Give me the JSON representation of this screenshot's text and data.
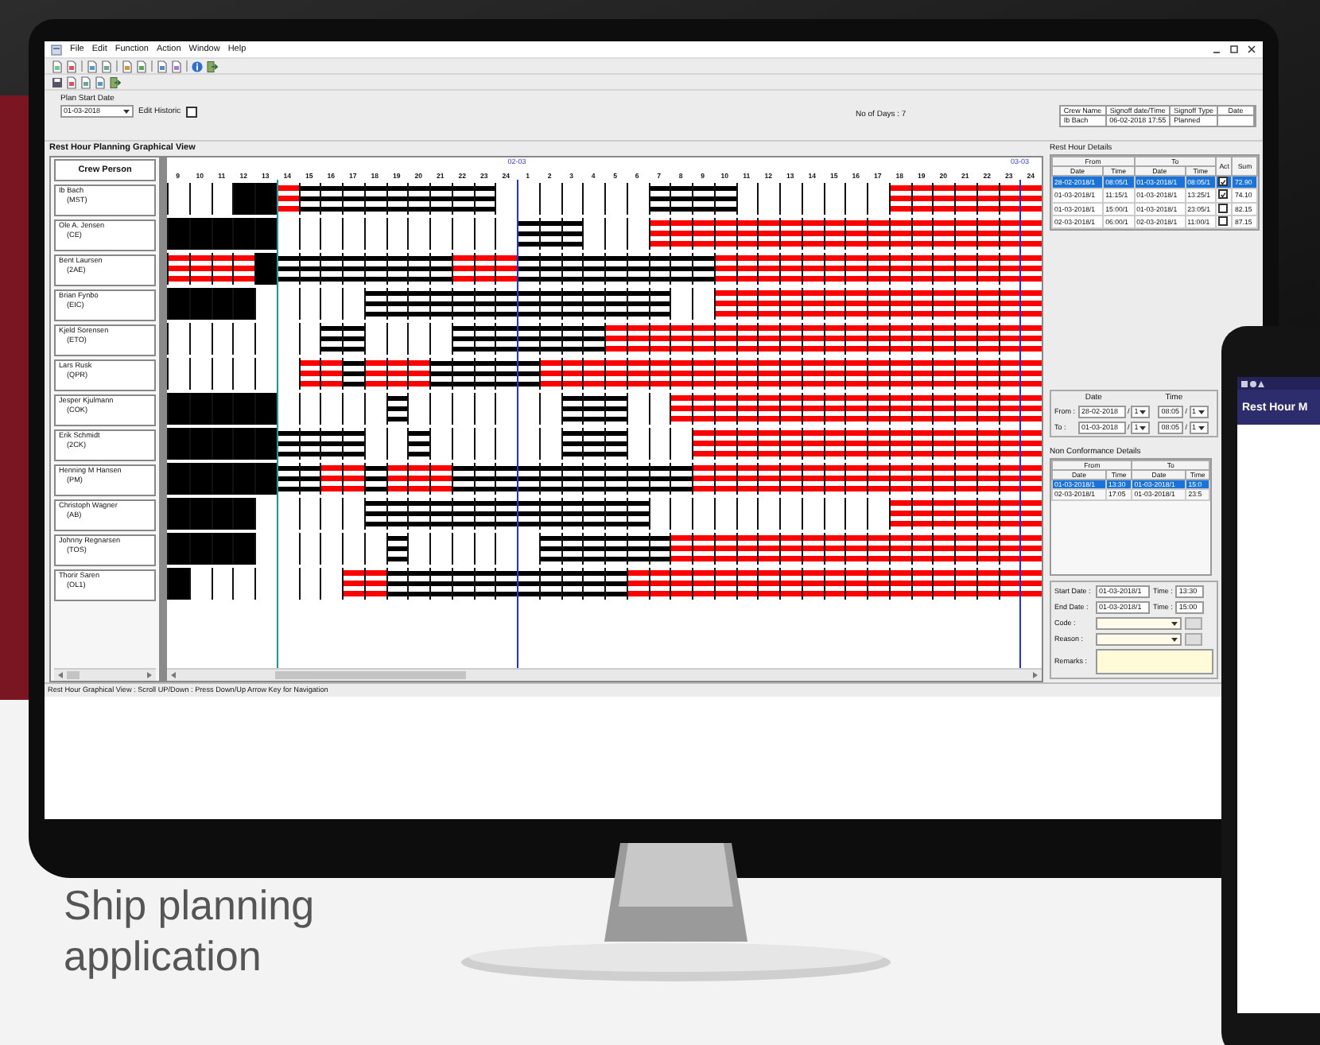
{
  "window": {
    "menu": [
      "File",
      "Edit",
      "Function",
      "Action",
      "Window",
      "Help"
    ]
  },
  "plan_start": {
    "label": "Plan Start Date",
    "value": "01-03-2018",
    "edit_historic": {
      "label": "Edit Historic",
      "checked": false
    }
  },
  "days": "No of Days : 7",
  "signoff": [
    {
      "header": "Crew Name",
      "value": "Ib Bach"
    },
    {
      "header": "Signoff date/Time",
      "value": "06-02-2018 17:55"
    },
    {
      "header": "Signoff Type",
      "value": "Planned"
    },
    {
      "header": "Date"
    }
  ],
  "graph": {
    "title": "Rest Hour Planning Graphical View",
    "crew_header": "Crew Person",
    "hours": [
      {
        "label": "9"
      },
      {
        "label": "10"
      },
      {
        "label": "11"
      },
      {
        "label": "12"
      },
      {
        "label": "13"
      },
      {
        "label": "14",
        "current": true
      },
      {
        "label": "15"
      },
      {
        "label": "16"
      },
      {
        "label": "17"
      },
      {
        "label": "18"
      },
      {
        "label": "19"
      },
      {
        "label": "20"
      },
      {
        "label": "21"
      },
      {
        "label": "22"
      },
      {
        "label": "23"
      },
      {
        "label": "24"
      },
      {
        "label": "1",
        "date": "02-03"
      },
      {
        "label": "2"
      },
      {
        "label": "3"
      },
      {
        "label": "4"
      },
      {
        "label": "5"
      },
      {
        "label": "6"
      },
      {
        "label": "7"
      },
      {
        "label": "8"
      },
      {
        "label": "9"
      },
      {
        "label": "10"
      },
      {
        "label": "11"
      },
      {
        "label": "12"
      },
      {
        "label": "13"
      },
      {
        "label": "14"
      },
      {
        "label": "15"
      },
      {
        "label": "16"
      },
      {
        "label": "17"
      },
      {
        "label": "18"
      },
      {
        "label": "19"
      },
      {
        "label": "20"
      },
      {
        "label": "21"
      },
      {
        "label": "22"
      },
      {
        "label": "23"
      },
      {
        "label": "24",
        "date": "03-03"
      }
    ],
    "crew": [
      {
        "name": "Ib Bach",
        "rank": "(MST)",
        "hours": [
          {
            "kind": "empty"
          },
          {
            "kind": "empty"
          },
          {
            "kind": "empty"
          },
          {
            "kind": "solid"
          },
          {
            "kind": "solid"
          },
          {
            "kind": "violation"
          },
          {
            "kind": "planned"
          },
          {
            "kind": "planned"
          },
          {
            "kind": "planned"
          },
          {
            "kind": "planned"
          },
          {
            "kind": "planned"
          },
          {
            "kind": "planned"
          },
          {
            "kind": "planned"
          },
          {
            "kind": "planned"
          },
          {
            "kind": "planned"
          },
          {
            "kind": "empty"
          },
          {
            "kind": "empty"
          },
          {
            "kind": "empty"
          },
          {
            "kind": "empty"
          },
          {
            "kind": "empty"
          },
          {
            "kind": "empty"
          },
          {
            "kind": "empty"
          },
          {
            "kind": "planned"
          },
          {
            "kind": "planned"
          },
          {
            "kind": "planned"
          },
          {
            "kind": "planned"
          },
          {
            "kind": "empty"
          },
          {
            "kind": "empty"
          },
          {
            "kind": "empty"
          },
          {
            "kind": "empty"
          },
          {
            "kind": "empty"
          },
          {
            "kind": "empty"
          },
          {
            "kind": "empty"
          },
          {
            "kind": "violation"
          },
          {
            "kind": "violation"
          },
          {
            "kind": "violation"
          },
          {
            "kind": "violation"
          },
          {
            "kind": "violation"
          },
          {
            "kind": "violation"
          },
          {
            "kind": "violation"
          }
        ]
      },
      {
        "name": "Ole A. Jensen",
        "rank": "(CE)",
        "hours": [
          {
            "kind": "solid"
          },
          {
            "kind": "solid"
          },
          {
            "kind": "solid"
          },
          {
            "kind": "solid"
          },
          {
            "kind": "solid"
          },
          {
            "kind": "empty"
          },
          {
            "kind": "empty"
          },
          {
            "kind": "empty"
          },
          {
            "kind": "empty"
          },
          {
            "kind": "empty"
          },
          {
            "kind": "empty"
          },
          {
            "kind": "empty"
          },
          {
            "kind": "empty"
          },
          {
            "kind": "empty"
          },
          {
            "kind": "empty"
          },
          {
            "kind": "empty"
          },
          {
            "kind": "planned"
          },
          {
            "kind": "planned"
          },
          {
            "kind": "planned"
          },
          {
            "kind": "empty"
          },
          {
            "kind": "empty"
          },
          {
            "kind": "empty"
          },
          {
            "kind": "violation"
          },
          {
            "kind": "violation"
          },
          {
            "kind": "violation"
          },
          {
            "kind": "violation"
          },
          {
            "kind": "violation"
          },
          {
            "kind": "violation"
          },
          {
            "kind": "violation"
          },
          {
            "kind": "violation"
          },
          {
            "kind": "violation"
          },
          {
            "kind": "violation"
          },
          {
            "kind": "violation"
          },
          {
            "kind": "violation"
          },
          {
            "kind": "violation"
          },
          {
            "kind": "violation"
          },
          {
            "kind": "violation"
          },
          {
            "kind": "violation"
          },
          {
            "kind": "violation"
          },
          {
            "kind": "violation"
          }
        ]
      },
      {
        "name": "Bent Laursen",
        "rank": "(2AE)",
        "hours": [
          {
            "kind": "violation"
          },
          {
            "kind": "violation"
          },
          {
            "kind": "violation"
          },
          {
            "kind": "violation"
          },
          {
            "kind": "solid"
          },
          {
            "kind": "planned"
          },
          {
            "kind": "planned"
          },
          {
            "kind": "planned"
          },
          {
            "kind": "planned"
          },
          {
            "kind": "planned"
          },
          {
            "kind": "planned"
          },
          {
            "kind": "planned"
          },
          {
            "kind": "planned"
          },
          {
            "kind": "violation"
          },
          {
            "kind": "violation"
          },
          {
            "kind": "violation"
          },
          {
            "kind": "planned"
          },
          {
            "kind": "planned"
          },
          {
            "kind": "planned"
          },
          {
            "kind": "planned"
          },
          {
            "kind": "planned"
          },
          {
            "kind": "planned"
          },
          {
            "kind": "planned"
          },
          {
            "kind": "planned"
          },
          {
            "kind": "planned"
          },
          {
            "kind": "violation"
          },
          {
            "kind": "violation"
          },
          {
            "kind": "violation"
          },
          {
            "kind": "violation"
          },
          {
            "kind": "violation"
          },
          {
            "kind": "violation"
          },
          {
            "kind": "violation"
          },
          {
            "kind": "violation"
          },
          {
            "kind": "violation"
          },
          {
            "kind": "violation"
          },
          {
            "kind": "violation"
          },
          {
            "kind": "violation"
          },
          {
            "kind": "violation"
          },
          {
            "kind": "violation"
          },
          {
            "kind": "violation"
          }
        ]
      },
      {
        "name": "Brian Fynbo",
        "rank": "(EIC)",
        "hours": [
          {
            "kind": "solid"
          },
          {
            "kind": "solid"
          },
          {
            "kind": "solid"
          },
          {
            "kind": "solid"
          },
          {
            "kind": "empty"
          },
          {
            "kind": "empty"
          },
          {
            "kind": "empty"
          },
          {
            "kind": "empty"
          },
          {
            "kind": "empty"
          },
          {
            "kind": "planned"
          },
          {
            "kind": "planned"
          },
          {
            "kind": "planned"
          },
          {
            "kind": "planned"
          },
          {
            "kind": "planned"
          },
          {
            "kind": "planned"
          },
          {
            "kind": "planned"
          },
          {
            "kind": "planned"
          },
          {
            "kind": "planned"
          },
          {
            "kind": "planned"
          },
          {
            "kind": "planned"
          },
          {
            "kind": "planned"
          },
          {
            "kind": "planned"
          },
          {
            "kind": "planned"
          },
          {
            "kind": "empty"
          },
          {
            "kind": "empty"
          },
          {
            "kind": "violation"
          },
          {
            "kind": "violation"
          },
          {
            "kind": "violation"
          },
          {
            "kind": "violation"
          },
          {
            "kind": "violation"
          },
          {
            "kind": "violation"
          },
          {
            "kind": "violation"
          },
          {
            "kind": "violation"
          },
          {
            "kind": "violation"
          },
          {
            "kind": "violation"
          },
          {
            "kind": "violation"
          },
          {
            "kind": "violation"
          },
          {
            "kind": "violation"
          },
          {
            "kind": "violation"
          },
          {
            "kind": "violation"
          }
        ]
      },
      {
        "name": "Kjeld Sorensen",
        "rank": "(ETO)",
        "hours": [
          {
            "kind": "empty"
          },
          {
            "kind": "empty"
          },
          {
            "kind": "empty"
          },
          {
            "kind": "empty"
          },
          {
            "kind": "empty"
          },
          {
            "kind": "empty"
          },
          {
            "kind": "empty"
          },
          {
            "kind": "planned"
          },
          {
            "kind": "planned"
          },
          {
            "kind": "empty"
          },
          {
            "kind": "empty"
          },
          {
            "kind": "empty"
          },
          {
            "kind": "empty"
          },
          {
            "kind": "planned"
          },
          {
            "kind": "planned"
          },
          {
            "kind": "planned"
          },
          {
            "kind": "planned"
          },
          {
            "kind": "planned"
          },
          {
            "kind": "planned"
          },
          {
            "kind": "planned"
          },
          {
            "kind": "violation"
          },
          {
            "kind": "violation"
          },
          {
            "kind": "violation"
          },
          {
            "kind": "violation"
          },
          {
            "kind": "violation"
          },
          {
            "kind": "violation"
          },
          {
            "kind": "violation"
          },
          {
            "kind": "violation"
          },
          {
            "kind": "violation"
          },
          {
            "kind": "violation"
          },
          {
            "kind": "violation"
          },
          {
            "kind": "violation"
          },
          {
            "kind": "violation"
          },
          {
            "kind": "violation"
          },
          {
            "kind": "violation"
          },
          {
            "kind": "violation"
          },
          {
            "kind": "violation"
          },
          {
            "kind": "violation"
          },
          {
            "kind": "violation"
          },
          {
            "kind": "violation"
          }
        ]
      },
      {
        "name": "Lars Rusk",
        "rank": "(QPR)",
        "hours": [
          {
            "kind": "empty"
          },
          {
            "kind": "empty"
          },
          {
            "kind": "empty"
          },
          {
            "kind": "empty"
          },
          {
            "kind": "empty"
          },
          {
            "kind": "empty"
          },
          {
            "kind": "violation"
          },
          {
            "kind": "violation"
          },
          {
            "kind": "planned"
          },
          {
            "kind": "violation"
          },
          {
            "kind": "violation"
          },
          {
            "kind": "violation"
          },
          {
            "kind": "planned"
          },
          {
            "kind": "planned"
          },
          {
            "kind": "planned"
          },
          {
            "kind": "planned"
          },
          {
            "kind": "planned"
          },
          {
            "kind": "violation"
          },
          {
            "kind": "violation"
          },
          {
            "kind": "violation"
          },
          {
            "kind": "violation"
          },
          {
            "kind": "violation"
          },
          {
            "kind": "violation"
          },
          {
            "kind": "violation"
          },
          {
            "kind": "violation"
          },
          {
            "kind": "violation"
          },
          {
            "kind": "violation"
          },
          {
            "kind": "violation"
          },
          {
            "kind": "violation"
          },
          {
            "kind": "violation"
          },
          {
            "kind": "violation"
          },
          {
            "kind": "violation"
          },
          {
            "kind": "violation"
          },
          {
            "kind": "violation"
          },
          {
            "kind": "violation"
          },
          {
            "kind": "violation"
          },
          {
            "kind": "violation"
          },
          {
            "kind": "violation"
          },
          {
            "kind": "violation"
          },
          {
            "kind": "violation"
          }
        ]
      },
      {
        "name": "Jesper Kjulmann",
        "rank": "(COK)",
        "hours": [
          {
            "kind": "solid"
          },
          {
            "kind": "solid"
          },
          {
            "kind": "solid"
          },
          {
            "kind": "solid"
          },
          {
            "kind": "solid"
          },
          {
            "kind": "empty"
          },
          {
            "kind": "empty"
          },
          {
            "kind": "empty"
          },
          {
            "kind": "empty"
          },
          {
            "kind": "empty"
          },
          {
            "kind": "planned"
          },
          {
            "kind": "empty"
          },
          {
            "kind": "empty"
          },
          {
            "kind": "empty"
          },
          {
            "kind": "empty"
          },
          {
            "kind": "empty"
          },
          {
            "kind": "empty"
          },
          {
            "kind": "empty"
          },
          {
            "kind": "planned"
          },
          {
            "kind": "planned"
          },
          {
            "kind": "planned"
          },
          {
            "kind": "empty"
          },
          {
            "kind": "empty"
          },
          {
            "kind": "violation"
          },
          {
            "kind": "violation"
          },
          {
            "kind": "violation"
          },
          {
            "kind": "violation"
          },
          {
            "kind": "violation"
          },
          {
            "kind": "violation"
          },
          {
            "kind": "violation"
          },
          {
            "kind": "violation"
          },
          {
            "kind": "violation"
          },
          {
            "kind": "violation"
          },
          {
            "kind": "violation"
          },
          {
            "kind": "violation"
          },
          {
            "kind": "violation"
          },
          {
            "kind": "violation"
          },
          {
            "kind": "violation"
          },
          {
            "kind": "violation"
          },
          {
            "kind": "violation"
          }
        ]
      },
      {
        "name": "Erik Schmidt",
        "rank": "(2CK)",
        "hours": [
          {
            "kind": "solid"
          },
          {
            "kind": "solid"
          },
          {
            "kind": "solid"
          },
          {
            "kind": "solid"
          },
          {
            "kind": "solid"
          },
          {
            "kind": "planned"
          },
          {
            "kind": "planned"
          },
          {
            "kind": "planned"
          },
          {
            "kind": "planned"
          },
          {
            "kind": "empty"
          },
          {
            "kind": "empty"
          },
          {
            "kind": "planned"
          },
          {
            "kind": "empty"
          },
          {
            "kind": "empty"
          },
          {
            "kind": "empty"
          },
          {
            "kind": "empty"
          },
          {
            "kind": "empty"
          },
          {
            "kind": "empty"
          },
          {
            "kind": "planned"
          },
          {
            "kind": "planned"
          },
          {
            "kind": "planned"
          },
          {
            "kind": "empty"
          },
          {
            "kind": "empty"
          },
          {
            "kind": "empty"
          },
          {
            "kind": "violation"
          },
          {
            "kind": "violation"
          },
          {
            "kind": "violation"
          },
          {
            "kind": "violation"
          },
          {
            "kind": "violation"
          },
          {
            "kind": "violation"
          },
          {
            "kind": "violation"
          },
          {
            "kind": "violation"
          },
          {
            "kind": "violation"
          },
          {
            "kind": "violation"
          },
          {
            "kind": "violation"
          },
          {
            "kind": "violation"
          },
          {
            "kind": "violation"
          },
          {
            "kind": "violation"
          },
          {
            "kind": "violation"
          },
          {
            "kind": "violation"
          }
        ]
      },
      {
        "name": "Henning M Hansen",
        "rank": "(PM)",
        "hours": [
          {
            "kind": "solid"
          },
          {
            "kind": "solid"
          },
          {
            "kind": "solid"
          },
          {
            "kind": "solid"
          },
          {
            "kind": "solid"
          },
          {
            "kind": "planned"
          },
          {
            "kind": "planned"
          },
          {
            "kind": "violation"
          },
          {
            "kind": "violation"
          },
          {
            "kind": "planned"
          },
          {
            "kind": "violation"
          },
          {
            "kind": "violation"
          },
          {
            "kind": "violation"
          },
          {
            "kind": "planned"
          },
          {
            "kind": "planned"
          },
          {
            "kind": "planned"
          },
          {
            "kind": "planned"
          },
          {
            "kind": "planned"
          },
          {
            "kind": "planned"
          },
          {
            "kind": "planned"
          },
          {
            "kind": "planned"
          },
          {
            "kind": "planned"
          },
          {
            "kind": "planned"
          },
          {
            "kind": "planned"
          },
          {
            "kind": "violation"
          },
          {
            "kind": "violation"
          },
          {
            "kind": "violation"
          },
          {
            "kind": "violation"
          },
          {
            "kind": "violation"
          },
          {
            "kind": "violation"
          },
          {
            "kind": "violation"
          },
          {
            "kind": "violation"
          },
          {
            "kind": "violation"
          },
          {
            "kind": "violation"
          },
          {
            "kind": "violation"
          },
          {
            "kind": "violation"
          },
          {
            "kind": "violation"
          },
          {
            "kind": "violation"
          },
          {
            "kind": "violation"
          },
          {
            "kind": "violation"
          }
        ]
      },
      {
        "name": "Christoph Wagner",
        "rank": "(AB)",
        "hours": [
          {
            "kind": "solid"
          },
          {
            "kind": "solid"
          },
          {
            "kind": "solid"
          },
          {
            "kind": "solid"
          },
          {
            "kind": "empty"
          },
          {
            "kind": "empty"
          },
          {
            "kind": "empty"
          },
          {
            "kind": "empty"
          },
          {
            "kind": "empty"
          },
          {
            "kind": "planned"
          },
          {
            "kind": "planned"
          },
          {
            "kind": "planned"
          },
          {
            "kind": "planned"
          },
          {
            "kind": "planned"
          },
          {
            "kind": "planned"
          },
          {
            "kind": "planned"
          },
          {
            "kind": "planned"
          },
          {
            "kind": "planned"
          },
          {
            "kind": "planned"
          },
          {
            "kind": "planned"
          },
          {
            "kind": "planned"
          },
          {
            "kind": "planned"
          },
          {
            "kind": "empty"
          },
          {
            "kind": "empty"
          },
          {
            "kind": "empty"
          },
          {
            "kind": "empty"
          },
          {
            "kind": "empty"
          },
          {
            "kind": "empty"
          },
          {
            "kind": "empty"
          },
          {
            "kind": "empty"
          },
          {
            "kind": "empty"
          },
          {
            "kind": "empty"
          },
          {
            "kind": "empty"
          },
          {
            "kind": "violation"
          },
          {
            "kind": "violation"
          },
          {
            "kind": "violation"
          },
          {
            "kind": "violation"
          },
          {
            "kind": "violation"
          },
          {
            "kind": "violation"
          },
          {
            "kind": "violation"
          }
        ]
      },
      {
        "name": "Johnny Regnarsen",
        "rank": "(TOS)",
        "hours": [
          {
            "kind": "solid"
          },
          {
            "kind": "solid"
          },
          {
            "kind": "solid"
          },
          {
            "kind": "solid"
          },
          {
            "kind": "empty"
          },
          {
            "kind": "empty"
          },
          {
            "kind": "empty"
          },
          {
            "kind": "empty"
          },
          {
            "kind": "empty"
          },
          {
            "kind": "empty"
          },
          {
            "kind": "planned"
          },
          {
            "kind": "empty"
          },
          {
            "kind": "empty"
          },
          {
            "kind": "empty"
          },
          {
            "kind": "empty"
          },
          {
            "kind": "empty"
          },
          {
            "kind": "empty"
          },
          {
            "kind": "planned"
          },
          {
            "kind": "planned"
          },
          {
            "kind": "planned"
          },
          {
            "kind": "planned"
          },
          {
            "kind": "planned"
          },
          {
            "kind": "planned"
          },
          {
            "kind": "violation"
          },
          {
            "kind": "violation"
          },
          {
            "kind": "violation"
          },
          {
            "kind": "violation"
          },
          {
            "kind": "violation"
          },
          {
            "kind": "violation"
          },
          {
            "kind": "violation"
          },
          {
            "kind": "violation"
          },
          {
            "kind": "violation"
          },
          {
            "kind": "violation"
          },
          {
            "kind": "violation"
          },
          {
            "kind": "violation"
          },
          {
            "kind": "violation"
          },
          {
            "kind": "violation"
          },
          {
            "kind": "violation"
          },
          {
            "kind": "violation"
          },
          {
            "kind": "violation"
          }
        ]
      },
      {
        "name": "Thorir Saren",
        "rank": "(OL1)",
        "hours": [
          {
            "kind": "solid"
          },
          {
            "kind": "empty"
          },
          {
            "kind": "empty"
          },
          {
            "kind": "empty"
          },
          {
            "kind": "empty"
          },
          {
            "kind": "empty"
          },
          {
            "kind": "empty"
          },
          {
            "kind": "empty"
          },
          {
            "kind": "violation"
          },
          {
            "kind": "violation"
          },
          {
            "kind": "planned"
          },
          {
            "kind": "planned"
          },
          {
            "kind": "planned"
          },
          {
            "kind": "planned"
          },
          {
            "kind": "planned"
          },
          {
            "kind": "planned"
          },
          {
            "kind": "planned"
          },
          {
            "kind": "planned"
          },
          {
            "kind": "planned"
          },
          {
            "kind": "planned"
          },
          {
            "kind": "planned"
          },
          {
            "kind": "violation"
          },
          {
            "kind": "violation"
          },
          {
            "kind": "violation"
          },
          {
            "kind": "violation"
          },
          {
            "kind": "violation"
          },
          {
            "kind": "violation"
          },
          {
            "kind": "violation"
          },
          {
            "kind": "violation"
          },
          {
            "kind": "violation"
          },
          {
            "kind": "violation"
          },
          {
            "kind": "violation"
          },
          {
            "kind": "violation"
          },
          {
            "kind": "violation"
          },
          {
            "kind": "violation"
          },
          {
            "kind": "violation"
          },
          {
            "kind": "violation"
          },
          {
            "kind": "violation"
          },
          {
            "kind": "violation"
          },
          {
            "kind": "violation"
          }
        ]
      }
    ]
  },
  "rest_hours": {
    "title": "Rest Hour Details",
    "groups": [
      "From",
      "To"
    ],
    "columns": [
      "Date",
      "Time",
      "Date",
      "Time"
    ],
    "act": "Act",
    "sum": "Sum",
    "rows": [
      {
        "selected": true,
        "cells": [
          "28-02-2018/1",
          "08:05/1",
          "01-03-2018/1",
          "08:05/1"
        ],
        "act": true,
        "sum": "72.90"
      },
      {
        "selected": false,
        "cells": [
          "01-03-2018/1",
          "11:15/1",
          "01-03-2018/1",
          "13:25/1"
        ],
        "act": true,
        "sum": "74.10"
      },
      {
        "selected": false,
        "cells": [
          "01-03-2018/1",
          "15:00/1",
          "01-03-2018/1",
          "23:05/1"
        ],
        "act": false,
        "sum": "82.15"
      },
      {
        "selected": false,
        "cells": [
          "02-03-2018/1",
          "06:00/1",
          "02-03-2018/1",
          "11:00/1"
        ],
        "act": false,
        "sum": "87.15"
      }
    ]
  },
  "period": {
    "date_header": "Date",
    "time_header": "Time",
    "rows": [
      {
        "label": "From :",
        "date": "28-02-2018",
        "sep": "/",
        "day": "1",
        "time": "08:05",
        "sep2": "/",
        "day2": "1"
      },
      {
        "label": "To :",
        "date": "01-03-2018",
        "sep": "/",
        "day": "1",
        "time": "08:05",
        "sep2": "/",
        "day2": "1"
      }
    ]
  },
  "non_conformance": {
    "title": "Non Conformance Details",
    "groups": [
      "From",
      "To"
    ],
    "columns": [
      "Date",
      "Time",
      "Date",
      "Time"
    ],
    "rows": [
      {
        "selected": true,
        "cells": [
          "01-03-2018/1",
          "13:30",
          "01-03-2018/1",
          "15:0"
        ]
      },
      {
        "selected": false,
        "cells": [
          "02-03-2018/1",
          "17:05",
          "01-03-2018/1",
          "23:5"
        ]
      }
    ]
  },
  "details": {
    "start": {
      "label": "Start Date :",
      "value": "01-03-2018/1",
      "time_label": "Time :",
      "time": "13:30"
    },
    "end": {
      "label": "End Date :",
      "value": "01-03-2018/1",
      "time_label": "Time :",
      "time": "15:00"
    },
    "code": {
      "label": "Code :"
    },
    "reason": {
      "label": "Reason :"
    },
    "remarks": {
      "label": "Remarks :"
    }
  },
  "status_bar": "Rest Hour Graphical View : Scroll UP/Down : Press Down/Up Arrow Key for Navigation",
  "phone": {
    "title": "Rest Hour M"
  },
  "caption": "Ship planning application"
}
